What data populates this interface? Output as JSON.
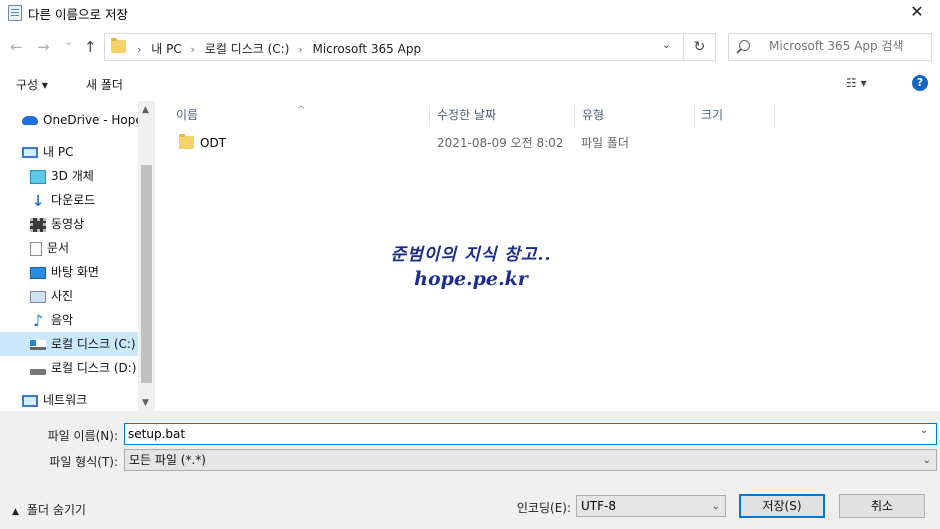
{
  "window": {
    "title": "다른 이름으로 저장",
    "close_glyph": "✕"
  },
  "address": {
    "back_glyph": "←",
    "forward_glyph": "→",
    "recent_glyph": "⌄",
    "up_glyph": "↑",
    "crumbs": [
      "내 PC",
      "로컬 디스크 (C:)",
      "Microsoft 365 App"
    ],
    "refresh_glyph": "↻",
    "search_placeholder": "Microsoft 365 App 검색"
  },
  "toolbar": {
    "organize": "구성 ▾",
    "new_folder": "새 폴더",
    "view_glyph": "☷ ▾",
    "help_glyph": "?"
  },
  "nav": {
    "items": [
      {
        "label": "OneDrive - Hope",
        "icon": "cloud-icon"
      },
      {
        "label": "내 PC",
        "icon": "computer-icon"
      },
      {
        "label": "3D 개체",
        "icon": "cube-icon"
      },
      {
        "label": "다운로드",
        "icon": "download-arrow-icon"
      },
      {
        "label": "동영상",
        "icon": "film-icon"
      },
      {
        "label": "문서",
        "icon": "document-icon"
      },
      {
        "label": "바탕 화면",
        "icon": "desktop-icon"
      },
      {
        "label": "사진",
        "icon": "picture-icon"
      },
      {
        "label": "음악",
        "icon": "music-note-icon"
      },
      {
        "label": "로컬 디스크 (C:)",
        "icon": "windows-drive-icon",
        "selected": true
      },
      {
        "label": "로컬 디스크 (D:)",
        "icon": "drive-icon"
      },
      {
        "label": "네트워크",
        "icon": "network-icon"
      }
    ]
  },
  "columns": [
    "이름",
    "수정한 날짜",
    "유형",
    "크기"
  ],
  "files": [
    {
      "name": "ODT",
      "modified": "2021-08-09 오전 8:02",
      "type": "파일 폴더",
      "size": ""
    }
  ],
  "watermark": {
    "line1": "준범이의 지식 창고..",
    "line2": "hope.pe.kr"
  },
  "form": {
    "filename_label": "파일 이름(N):",
    "filename_value": "setup.bat",
    "filetype_label": "파일 형식(T):",
    "filetype_value": "모든 파일 (*.*)",
    "hide_folders": "폴더 숨기기",
    "encoding_label": "인코딩(E):",
    "encoding_value": "UTF-8",
    "save": "저장(S)",
    "cancel": "취소"
  },
  "colors": {
    "accent": "#0078d7",
    "selected_bg": "#cce8ff",
    "header_text": "#4c607a"
  }
}
